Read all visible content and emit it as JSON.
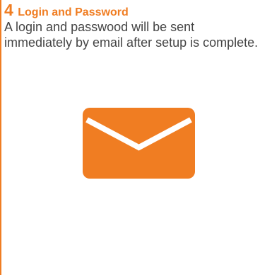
{
  "step": {
    "number": "4",
    "title": "Login and Password",
    "description": "A login and passwood will be sent immediately by email after setup is complete."
  },
  "icon": {
    "name": "envelope-icon",
    "color": "#f07d22"
  },
  "colors": {
    "accent": "#f07d22",
    "text": "#444444"
  }
}
